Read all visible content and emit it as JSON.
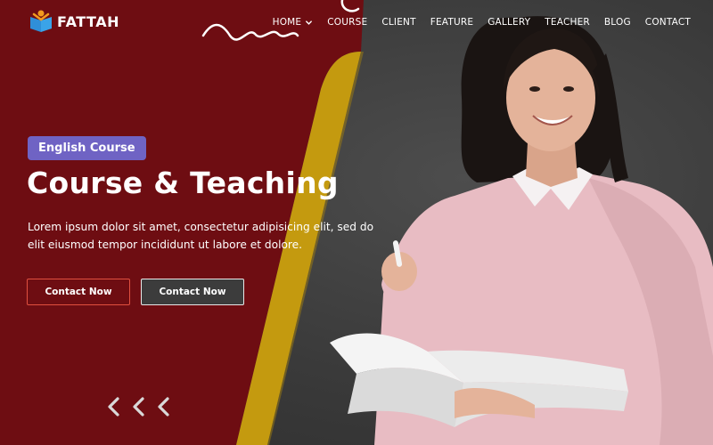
{
  "brand": {
    "name": "FATTAH",
    "icon": "book-reader-logo-icon"
  },
  "nav": {
    "items": [
      {
        "label": "HOME",
        "has_dropdown": true
      },
      {
        "label": "COURSE"
      },
      {
        "label": "CLIENT"
      },
      {
        "label": "FEATURE"
      },
      {
        "label": "GALLERY"
      },
      {
        "label": "TEACHER"
      },
      {
        "label": "BLOG"
      },
      {
        "label": "CONTACT"
      }
    ]
  },
  "hero": {
    "badge": "English Course",
    "title": "Course & Teaching",
    "description": "Lorem ipsum dolor sit amet, consectetur adipisicing elit, sed do elit eiusmod tempor incididunt ut labore et dolore.",
    "primary_button": "Contact Now",
    "secondary_button": "Contact Now",
    "slider_arrows": [
      "chevron-left-icon",
      "chevron-left-icon",
      "chevron-left-icon"
    ]
  },
  "colors": {
    "maroon": "#6e0d12",
    "gold": "#c49a0f",
    "badge": "#6f63c4",
    "button_border": "#e0503f"
  }
}
